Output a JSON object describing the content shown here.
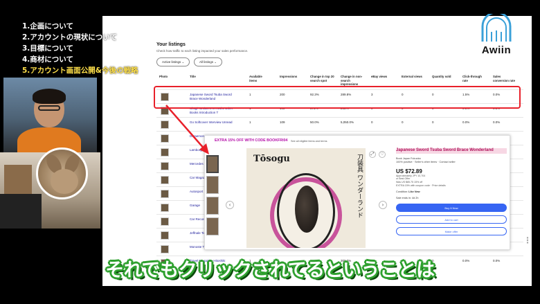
{
  "agenda": [
    "1.企画について",
    "2.アカウントの現状について",
    "3.目標について",
    "4.商材について",
    "5.アカウント画面公開&今後の戦略"
  ],
  "brand": {
    "logo_text": "Awiin",
    "logo_color": "#3aa0d8"
  },
  "listings": {
    "title": "Your listings",
    "subtitle": "Check how traffic to each listing impacted your sales performance.",
    "filter_active": "Active listings",
    "filter_all": "All listings",
    "columns": [
      "Photo",
      "Title",
      "Available items",
      "Impressions",
      "Change in top 20 search spot",
      "Change in non-search impressions",
      "eBay views",
      "External views",
      "Quantity sold",
      "Click-through rate",
      "Sales conversion rate"
    ],
    "rows": [
      {
        "title": "Japanese Sword Tsuba Sword Brace Wonderland",
        "available": "1",
        "impressions": "200",
        "top20": "92.3%",
        "nonsearch": "289.8%",
        "views": "3",
        "external": "0",
        "sold": "0",
        "ctr": "1.5%",
        "conv": "0.0%"
      },
      {
        "title": "Shogi Tomita RHR And 2 Other Books Introduction T",
        "available": "1",
        "impressions": "140",
        "top20": "875%",
        "nonsearch": "293%",
        "views": "0",
        "external": "0",
        "sold": "0",
        "ctr": "0.0%",
        "conv": "0.0%"
      },
      {
        "title": "Go Softcover Interview Unread",
        "available": "1",
        "impressions": "109",
        "top20": "50.0%",
        "nonsearch": "5,050.0%",
        "views": "0",
        "external": "0",
        "sold": "0",
        "ctr": "0.0%",
        "conv": "0.0%"
      },
      {
        "title": "Doraemon",
        "available": "",
        "impressions": "",
        "top20": "",
        "nonsearch": "",
        "views": "",
        "external": "",
        "sold": "",
        "ctr": "",
        "conv": ""
      },
      {
        "title": "Lamborghini",
        "available": "",
        "impressions": "",
        "top20": "",
        "nonsearch": "",
        "views": "",
        "external": "",
        "sold": "",
        "ctr": "",
        "conv": ""
      },
      {
        "title": "Mercedes Benz",
        "available": "",
        "impressions": "",
        "top20": "",
        "nonsearch": "",
        "views": "",
        "external": "",
        "sold": "",
        "ctr": "",
        "conv": ""
      },
      {
        "title": "Car Magazine",
        "available": "",
        "impressions": "",
        "top20": "",
        "nonsearch": "",
        "views": "",
        "external": "",
        "sold": "",
        "ctr": "",
        "conv": ""
      },
      {
        "title": "Autosport",
        "available": "",
        "impressions": "",
        "top20": "",
        "nonsearch": "",
        "views": "",
        "external": "",
        "sold": "",
        "ctr": "",
        "conv": ""
      },
      {
        "title": "Garage",
        "available": "",
        "impressions": "",
        "top20": "",
        "nonsearch": "",
        "views": "",
        "external": "",
        "sold": "",
        "ctr": "",
        "conv": ""
      },
      {
        "title": "Car Record",
        "available": "",
        "impressions": "",
        "top20": "",
        "nonsearch": "",
        "views": "",
        "external": "",
        "sold": "",
        "ctr": "",
        "conv": ""
      },
      {
        "title": "Jeffnale Ticket",
        "available": "",
        "impressions": "",
        "top20": "",
        "nonsearch": "",
        "views": "",
        "external": "",
        "sold": "",
        "ctr": "",
        "conv": ""
      },
      {
        "title": "Monoste Thewes",
        "available": "",
        "impressions": "",
        "top20": "",
        "nonsearch": "",
        "views": "",
        "external": "",
        "sold": "",
        "ctr": "",
        "conv": ""
      },
      {
        "title": "Travel Magazine Hitoshiki",
        "available": "1",
        "impressions": "",
        "top20": "",
        "nonsearch": "300.0%",
        "views": "0",
        "external": "0",
        "sold": "0",
        "ctr": "0.0%",
        "conv": "0.0%"
      }
    ]
  },
  "popup": {
    "coupon": "EXTRA 15% OFF WITH CODE BOOKFRI04",
    "coupon_link": "See all eligible items and terms",
    "book_title": "Tōsogu",
    "book_vertical": "刀装具 ワンダーランド",
    "item_title": "Japanese Sword Tsuba Sword Brace Wonderland",
    "seller": "Book Japan Fukuoka",
    "seller_meta": "100% positive · Seller's other items · Contact seller",
    "price": "US $72.89",
    "price_approx": "Approximately JPY 10,704",
    "price_or": "or Best Offer",
    "price_was": "Was US $85.75 15% off",
    "price_note": "EXTRA 15% with coupon code · Price details",
    "condition_label": "Condition:",
    "condition": "Like New",
    "sale_ends_label": "Sale ends in:",
    "sale_ends": "4d 2h",
    "buy_now": "Buy It Now",
    "add_to_cart": "Add to cart",
    "make_offer": "Make offer"
  },
  "subtitle": "それでもクリックされてるということは",
  "subtitle_ghost": "…",
  "colors": {
    "highlight": "#e8202a",
    "subtitle_outline": "#2ea02e",
    "agenda_active": "#ffe04a",
    "coupon": "#b40ea8"
  }
}
